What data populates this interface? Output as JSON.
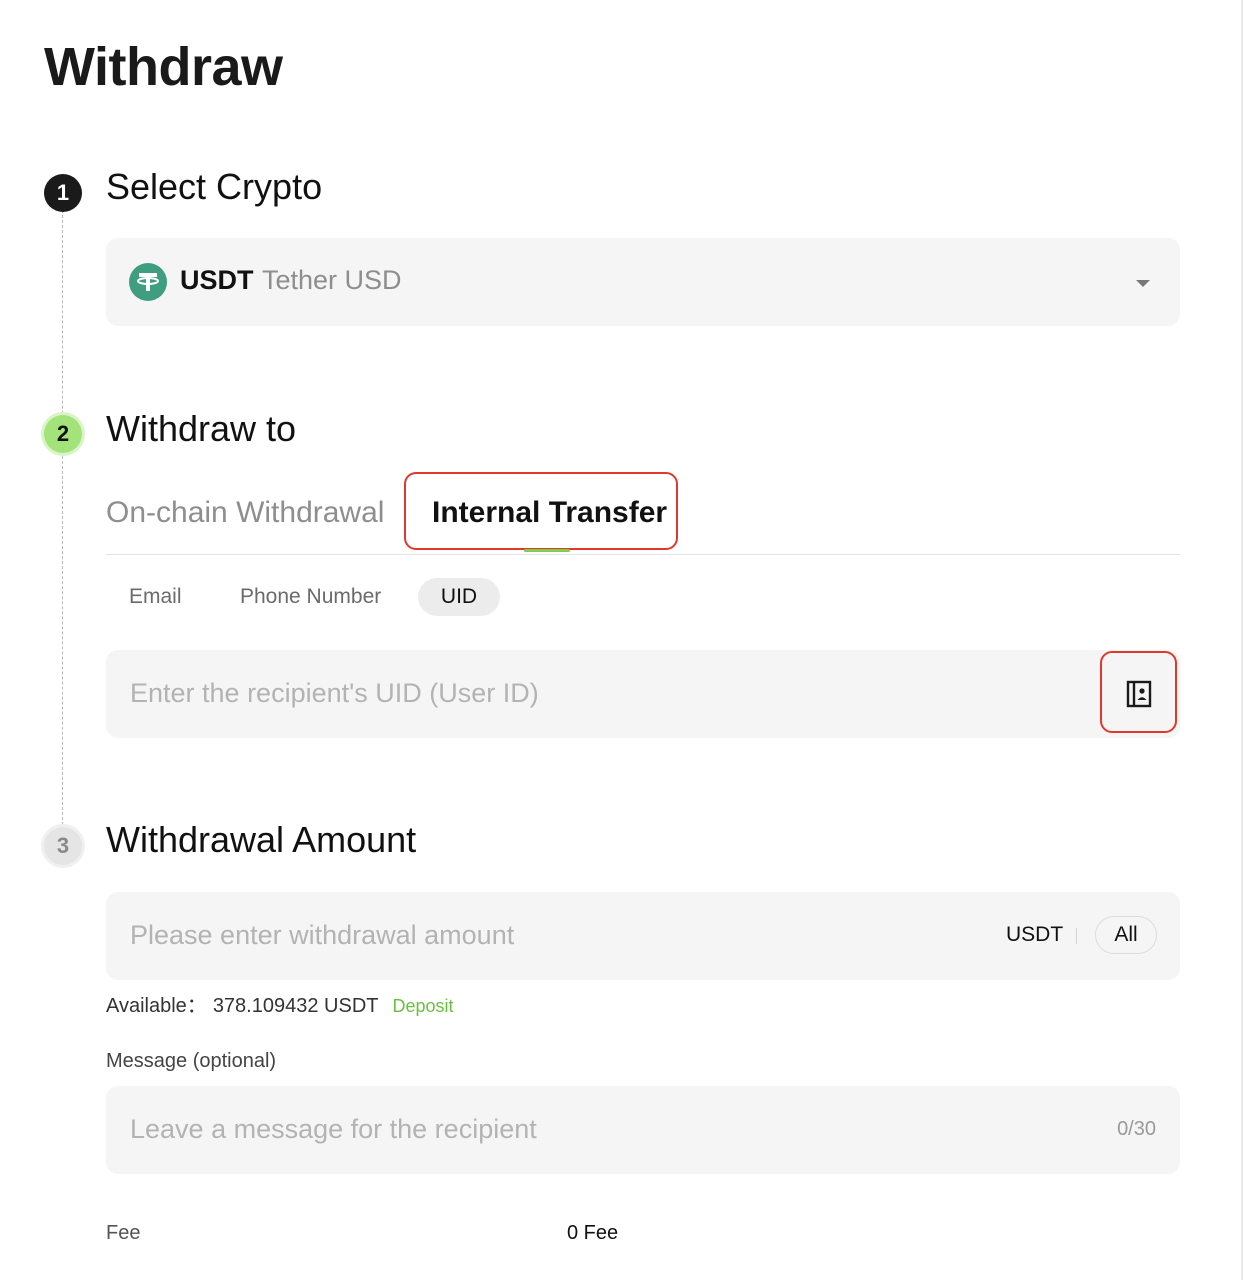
{
  "page": {
    "title": "Withdraw"
  },
  "steps": [
    {
      "number": "1",
      "title": "Select Crypto"
    },
    {
      "number": "2",
      "title": "Withdraw to"
    },
    {
      "number": "3",
      "title": "Withdrawal Amount"
    }
  ],
  "crypto": {
    "symbol": "USDT",
    "name": "Tether USD",
    "icon": "tether-icon",
    "icon_color": "#3f9e80"
  },
  "withdraw_to": {
    "tabs": [
      {
        "label": "On-chain Withdrawal",
        "active": false
      },
      {
        "label": "Internal Transfer",
        "active": true
      }
    ],
    "subtabs": [
      {
        "label": "Email",
        "active": false
      },
      {
        "label": "Phone Number",
        "active": false
      },
      {
        "label": "UID",
        "active": true
      }
    ],
    "recipient_placeholder": "Enter the recipient's UID (User ID)",
    "address_book_icon": "address-book-icon"
  },
  "amount": {
    "placeholder": "Please enter withdrawal amount",
    "unit": "USDT",
    "all_label": "All",
    "available_label": "Available：",
    "available_value": "378.109432 USDT",
    "deposit_label": "Deposit"
  },
  "message": {
    "label": "Message (optional)",
    "placeholder": "Leave a message for the recipient",
    "count": "0/30"
  },
  "fee": {
    "label": "Fee",
    "value": "0 Fee"
  },
  "colors": {
    "accent_green": "#7ecf4f",
    "highlight_red": "#e0392b",
    "step2_green": "#a3e37a"
  }
}
